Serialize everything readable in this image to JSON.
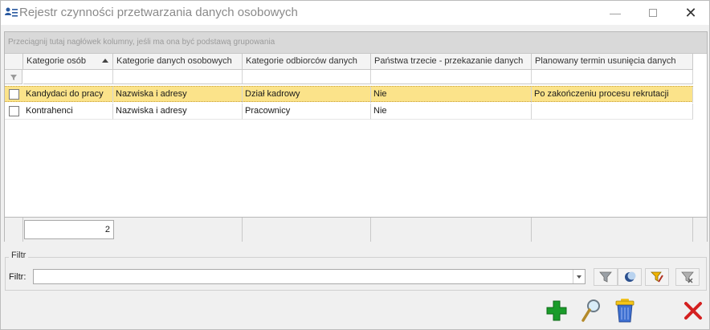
{
  "window": {
    "title": "Rejestr czynności przetwarzania danych osobowych",
    "icon": "users-register-icon",
    "controls": [
      "minimize-icon",
      "maximize-icon",
      "close-icon"
    ]
  },
  "grid": {
    "group_panel_hint": "Przeciągnij tutaj nagłówek kolumny, jeśli ma ona być podstawą grupowania",
    "columns": [
      {
        "label": "Kategorie osób",
        "sorted": "asc"
      },
      {
        "label": "Kategorie danych osobowych"
      },
      {
        "label": "Kategorie odbiorców danych"
      },
      {
        "label": "Państwa trzecie - przekazanie danych"
      },
      {
        "label": "Planowany termin usunięcia danych"
      }
    ],
    "rows": [
      {
        "selected": true,
        "checked": false,
        "cells": [
          "Kandydaci do pracy",
          "Nazwiska i adresy",
          "Dział kadrowy",
          "Nie",
          "Po zakończeniu procesu rekrutacji"
        ]
      },
      {
        "selected": false,
        "checked": false,
        "cells": [
          "Kontrahenci",
          "Nazwiska i adresy",
          "Pracownicy",
          "Nie",
          ""
        ]
      }
    ],
    "footer_count": "2",
    "selected_row_color": "#fbe38a"
  },
  "filter": {
    "group_label": "Filtr",
    "field_label": "Filtr:",
    "value": "",
    "buttons": [
      "funnel-icon",
      "moon-filter-icon",
      "funnel-edit-icon",
      "funnel-clear-icon"
    ]
  },
  "actions": {
    "buttons": [
      "add-icon",
      "preview-icon",
      "delete-icon",
      "cancel-icon"
    ],
    "colors": {
      "add": "#1a9c2a",
      "cancel": "#d42020"
    }
  }
}
